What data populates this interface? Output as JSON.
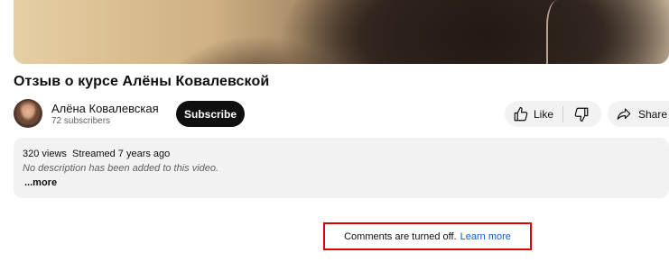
{
  "video": {
    "title": "Отзыв о курсе Алёны Ковалевской"
  },
  "channel": {
    "name": "Алёна Ковалевская",
    "subscribers": "72 subscribers",
    "subscribe_label": "Subscribe"
  },
  "actions": {
    "like_label": "Like",
    "share_label": "Share",
    "icons": [
      "thumbs-up-icon",
      "thumbs-down-icon",
      "share-arrow-icon"
    ]
  },
  "description": {
    "views": "320 views",
    "streamed": "Streamed 7 years ago",
    "text": "No description has been added to this video.",
    "more_label": "...more"
  },
  "comments": {
    "notice": "Comments are turned off.",
    "link_label": "Learn more",
    "highlight_color": "#e00000",
    "link_color": "#065fd4"
  }
}
